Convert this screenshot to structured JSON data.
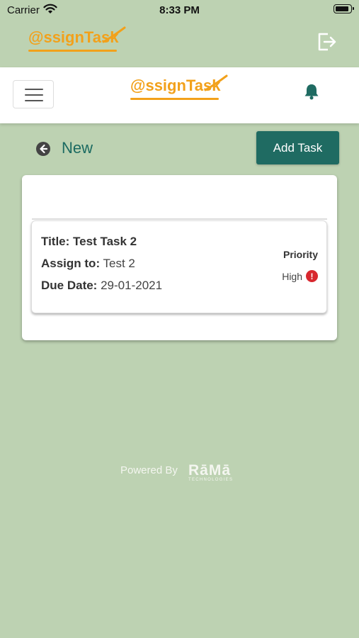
{
  "status_bar": {
    "carrier": "Carrier",
    "time": "8:33 PM"
  },
  "app": {
    "logo_text": "@ssignTask",
    "logo_parts": {
      "lead": "@ssign",
      "t": "T",
      "tail": "as",
      "k": "k"
    }
  },
  "page": {
    "title": "New",
    "add_task_label": "Add Task"
  },
  "task": {
    "title_label": "Title:",
    "title_value": "Test Task 2",
    "assign_label": "Assign to:",
    "assign_value": "Test 2",
    "due_label": "Due Date:",
    "due_value": "29-01-2021",
    "priority_label": "Priority",
    "priority_value": "High"
  },
  "footer": {
    "powered_by": "Powered By",
    "brand": "RāMā",
    "brand_sub": "TECHNOLOGIES"
  },
  "colors": {
    "background": "#bdd2b2",
    "accent": "#1f6b62",
    "logo": "#f2a11b",
    "alert": "#d8282f"
  },
  "icons": {
    "logout": "logout-icon",
    "menu": "hamburger-menu-icon",
    "bell": "bell-icon",
    "back": "back-circle-icon",
    "alert": "exclamation-circle-icon"
  }
}
